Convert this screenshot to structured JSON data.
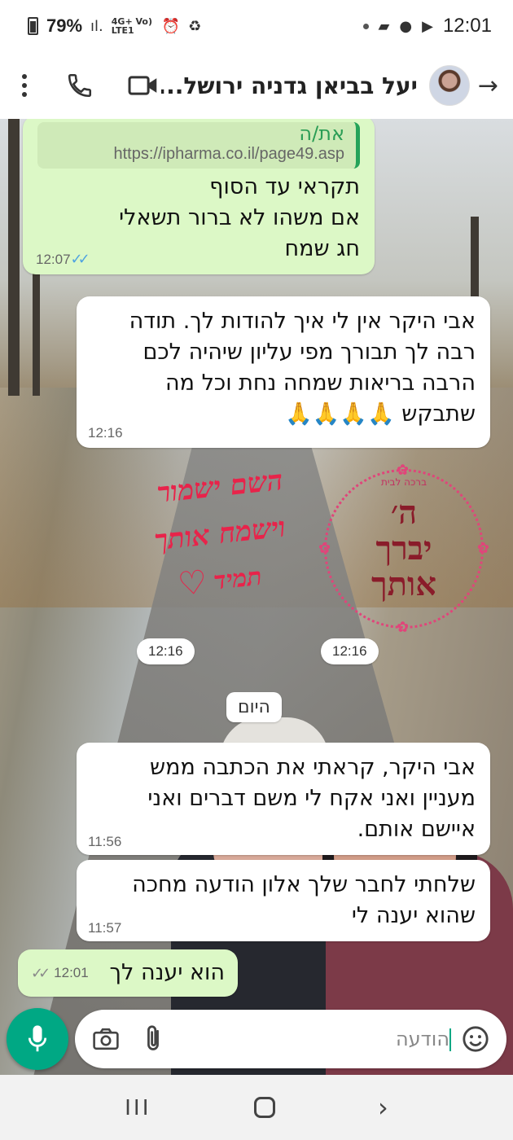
{
  "status_bar": {
    "battery": "79%",
    "network": "4G+ Vo) LTE1",
    "time": "12:01"
  },
  "header": {
    "contact_name": "יעל בביאן גדניה ירושל...",
    "icons": [
      "kebab-menu-icon",
      "phone-icon",
      "video-call-icon",
      "avatar",
      "back-arrow-icon"
    ]
  },
  "messages": [
    {
      "direction": "out",
      "quote_author": "את/ה",
      "quote_url": "https://ipharma.co.il/page49.asp",
      "lines": [
        "תקראי עד הסוף",
        "אם משהו לא ברור תשאלי",
        "חג שמח"
      ],
      "time": "12:07",
      "status": "read"
    },
    {
      "direction": "in",
      "lines": [
        "אבי היקר אין לי איך להודות לך. תודה",
        "רבה לך תבורך מפי עליון שיהיה לכם",
        "הרבה בריאות שמחה נחת וכל מה",
        "שתבקש 🙏🙏🙏🙏"
      ],
      "time": "12:16"
    },
    {
      "direction": "in",
      "type": "sticker",
      "lines": [
        "השם ישמור",
        "וישמח אותך",
        "תמיד"
      ],
      "time": "12:16"
    },
    {
      "direction": "in",
      "type": "sticker",
      "small_caption": "ברכה לבית",
      "lines": [
        "ה׳",
        "יברך",
        "אותך"
      ],
      "time": "12:16"
    },
    {
      "type": "date",
      "label": "היום"
    },
    {
      "direction": "in",
      "lines": [
        "אבי היקר, קראתי את הכתבה ממש",
        "מעניין ואני אקח לי משם דברים ואני",
        "איישם אותם."
      ],
      "time": "11:56"
    },
    {
      "direction": "in",
      "lines": [
        "שלחתי לחבר שלך אלון הודעה מחכה",
        "שהוא יענה לי"
      ],
      "time": "11:57"
    },
    {
      "direction": "out",
      "lines": [
        "הוא יענה לך"
      ],
      "time": "12:01",
      "status": "delivered"
    }
  ],
  "input": {
    "placeholder": "הודעה"
  },
  "colors": {
    "outgoing_bubble": "#dcf8c6",
    "incoming_bubble": "#ffffff",
    "accent": "#00a884",
    "read_ticks": "#4fa3e0"
  }
}
